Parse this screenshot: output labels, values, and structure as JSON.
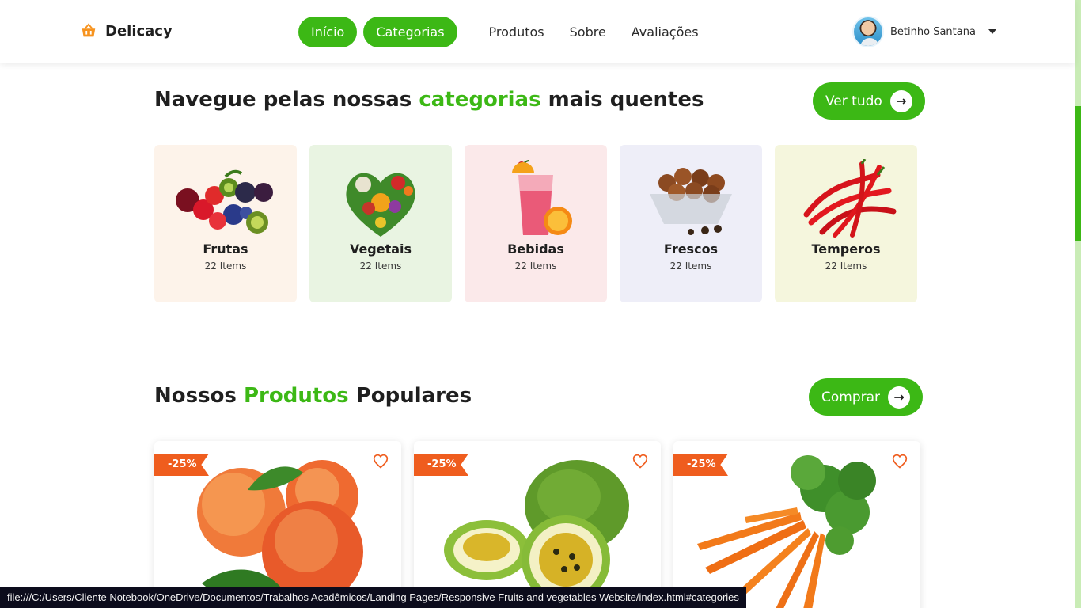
{
  "header": {
    "brand": "Delicacy",
    "nav": [
      {
        "label": "Início",
        "active": true
      },
      {
        "label": "Categorias",
        "active": true
      },
      {
        "label": "Produtos",
        "active": false
      },
      {
        "label": "Sobre",
        "active": false
      },
      {
        "label": "Avaliações",
        "active": false
      }
    ],
    "user_name": "Betinho Santana"
  },
  "categories_section": {
    "title_before": "Navegue pelas nossas ",
    "title_accent": "categorias",
    "title_after": " mais quentes",
    "button_label": "Ver tudo",
    "items": [
      {
        "name": "Frutas",
        "count": "22 Items",
        "bg": "#fdf3ea"
      },
      {
        "name": "Vegetais",
        "count": "22 Items",
        "bg": "#e9f4e2"
      },
      {
        "name": "Bebidas",
        "count": "22 Items",
        "bg": "#fbe9ea"
      },
      {
        "name": "Frescos",
        "count": "22 Items",
        "bg": "#eeeef8"
      },
      {
        "name": "Temperos",
        "count": "22 Items",
        "bg": "#f5f6dd"
      }
    ]
  },
  "products_section": {
    "title_before": "Nossos ",
    "title_accent": "Produtos",
    "title_after": " Populares",
    "button_label": "Comprar",
    "items": [
      {
        "discount": "-25%",
        "image": "peaches"
      },
      {
        "discount": "-25%",
        "image": "passion-fruit"
      },
      {
        "discount": "-25%",
        "image": "carrots"
      }
    ]
  },
  "status_bar": {
    "url": "file:///C:/Users/Cliente Notebook/OneDrive/Documentos/Trabalhos Acadêmicos/Landing Pages/Responsive Fruits and vegetables Website/index.html#categories"
  },
  "colors": {
    "accent": "#3cb815",
    "ribbon": "#ef5d1e",
    "heart": "#ef5d1e"
  }
}
